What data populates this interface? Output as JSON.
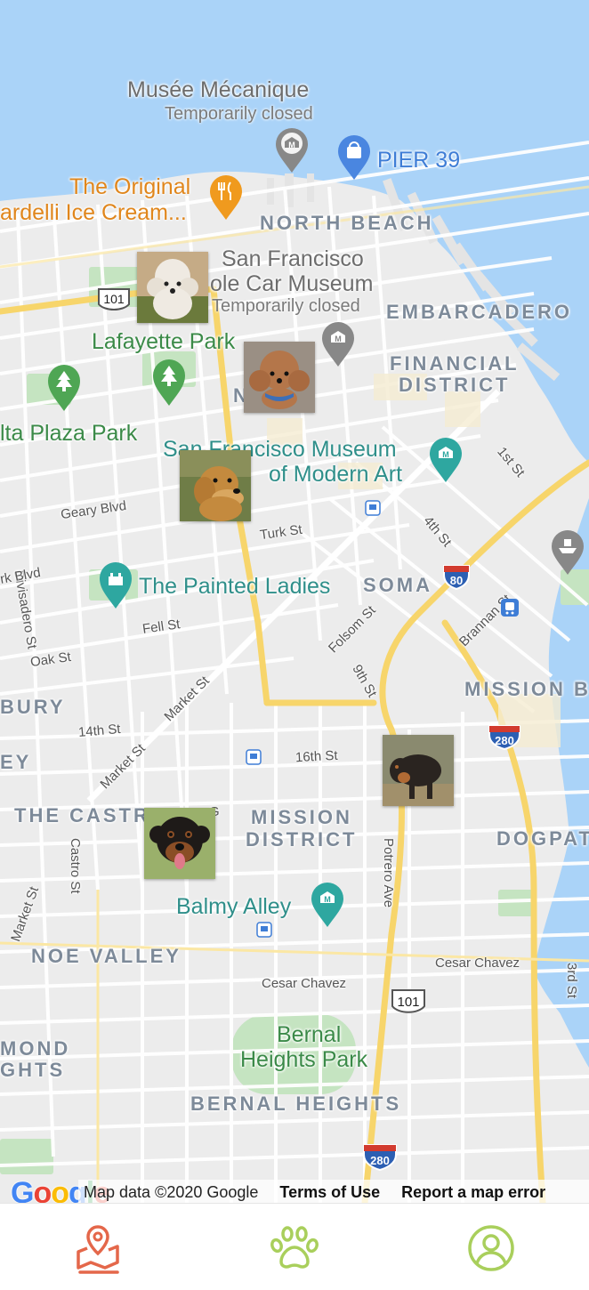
{
  "map": {
    "labels": {
      "musee": "Musée Mécanique",
      "musee_status": "Temporarily closed",
      "pier39": "PIER 39",
      "original_line1": "The Original",
      "original_line2": "ardelli Ice Cream...",
      "north_beach": "NORTH BEACH",
      "cable_line1": "San Francisco",
      "cable_line2": "ole Car Museum",
      "cable_status": "Temporarily closed",
      "embarcadero": "EMBARCADERO",
      "lafayette": "Lafayette Park",
      "financial_1": "FINANCIAL",
      "financial_2": "DISTRICT",
      "nob_hill": "N     LL",
      "alta_plaza": "lta Plaza Park",
      "sfmoma_1": "San Francisco Museum",
      "sfmoma_2": "of Modern Art",
      "first_st": "1st St",
      "geary": "Geary Blvd",
      "turk": "Turk St",
      "fourth_st": "4th St",
      "divisadero": "Divisadero St",
      "blvd": "rk Blvd",
      "painted_ladies": "The Painted Ladies",
      "soma": "SOMA",
      "brannan": "Brannan St",
      "fell": "Fell St",
      "folsom": "Folsom St",
      "oak": "Oak St",
      "market1": "Market St",
      "ninth": "9th St",
      "mission_bay": "MISSION B",
      "bury": "BURY",
      "fourteenth": "14th St",
      "market2": "Market St",
      "sixteenth": "16th St",
      "ey": "EY",
      "castro_district": "THE CASTR",
      "mission_1": "MISSION",
      "mission_2": "DISTRICT",
      "dogpatch": "DOGPAT",
      "castro_st": "Castro St",
      "potrero": "Potrero Ave",
      "market3": "Market St",
      "balmy": "Balmy Alley",
      "noe": "NOE VALLEY",
      "cesar1": "Cesar Chavez",
      "cesar2": "Cesar Chavez",
      "third": "3rd St",
      "richmond_1": "MOND",
      "richmond_2": "GHTS",
      "bernal_1": "Bernal",
      "bernal_2": "Heights Park",
      "bernal_heights": "BERNAL HEIGHTS",
      "g": "G"
    },
    "shields": {
      "us101_a": "101",
      "i80": "80",
      "i280_a": "280",
      "us101_b": "101",
      "i280_b": "280"
    },
    "dog_markers": [
      {
        "breed": "poodle",
        "color": "#e9e4dc"
      },
      {
        "breed": "toy-poodle",
        "color": "#b4764a"
      },
      {
        "breed": "golden-retriever",
        "color": "#c48a3e"
      },
      {
        "breed": "coonhound",
        "color": "#2a2420"
      },
      {
        "breed": "rottweiler",
        "color": "#1e1a18"
      }
    ]
  },
  "attribution": {
    "logo": "Google",
    "map_data": "Map data ©2020 Google",
    "terms": "Terms of Use",
    "report": "Report a map error"
  },
  "tabbar": {
    "tabs": [
      {
        "icon": "map-pin-icon",
        "active": true,
        "color": "#e4674a"
      },
      {
        "icon": "paw-icon",
        "active": false,
        "color": "#a9cf5c"
      },
      {
        "icon": "profile-icon",
        "active": false,
        "color": "#a9cf5c"
      }
    ]
  },
  "colors": {
    "water": "#aad3f8",
    "land": "#ececec",
    "highway": "#f7d56b",
    "park": "#c5e4c1",
    "accent_active": "#e4674a",
    "accent_inactive": "#a9cf5c"
  }
}
